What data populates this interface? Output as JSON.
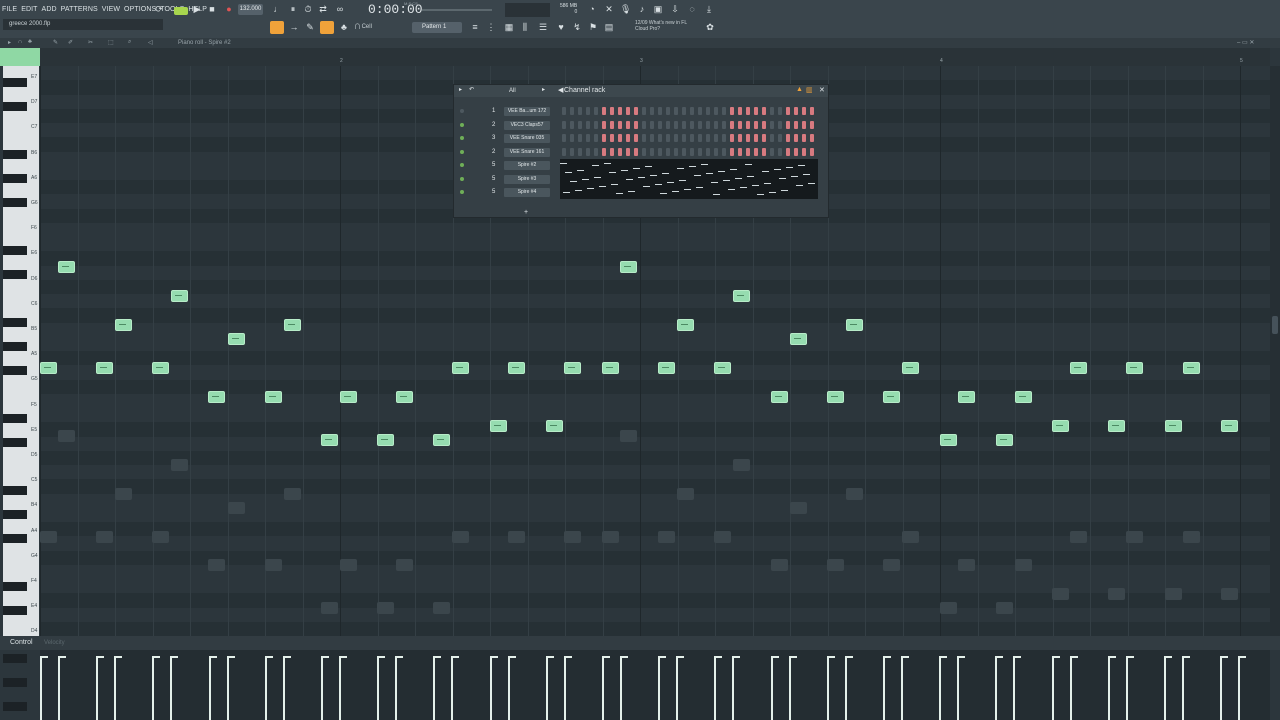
{
  "menu": [
    "FILE",
    "EDIT",
    "ADD",
    "PATTERNS",
    "VIEW",
    "OPTIONS",
    "TOOLS",
    "HELP"
  ],
  "project_name": "greece 2000.flp",
  "tempo": "132.000",
  "time_display": "0:00:00",
  "time_unit": "M:S:CS",
  "pattern_label": "Pattern 1",
  "snap_label": "Cell",
  "cpu": {
    "line1": "586 MB",
    "line2": "0"
  },
  "news": {
    "date": "12/09",
    "line1": "What's new in FL",
    "line2": "Cloud Pro?"
  },
  "piano_roll_title": "Piano roll - Spire #2",
  "ruler": [
    "2",
    "3",
    "4",
    "5"
  ],
  "key_labels": [
    "E7",
    "D7",
    "C7",
    "B6",
    "A6",
    "G6",
    "F6",
    "E6",
    "D6",
    "C6",
    "B5",
    "A5",
    "G5",
    "F5",
    "E5",
    "D5",
    "C5",
    "B4",
    "A4",
    "G4",
    "F4",
    "E4",
    "D4"
  ],
  "control_label": "Control",
  "control_sub": "Velocity",
  "channel_rack": {
    "title": "Channel rack",
    "filter": "All",
    "channels": [
      {
        "num": "1",
        "name": "VEE Ba...um 172"
      },
      {
        "num": "2",
        "name": "VEC3 Claps57"
      },
      {
        "num": "3",
        "name": "VEE Snare 035"
      },
      {
        "num": "2",
        "name": "VEE Snare 161"
      },
      {
        "num": "5",
        "name": "Spire #2"
      },
      {
        "num": "5",
        "name": "Spire #3"
      },
      {
        "num": "5",
        "name": "Spire #4"
      }
    ]
  },
  "colors": {
    "note": "#96dcb0",
    "step_on": "#d77a80",
    "accent": "#8fd8a4"
  }
}
